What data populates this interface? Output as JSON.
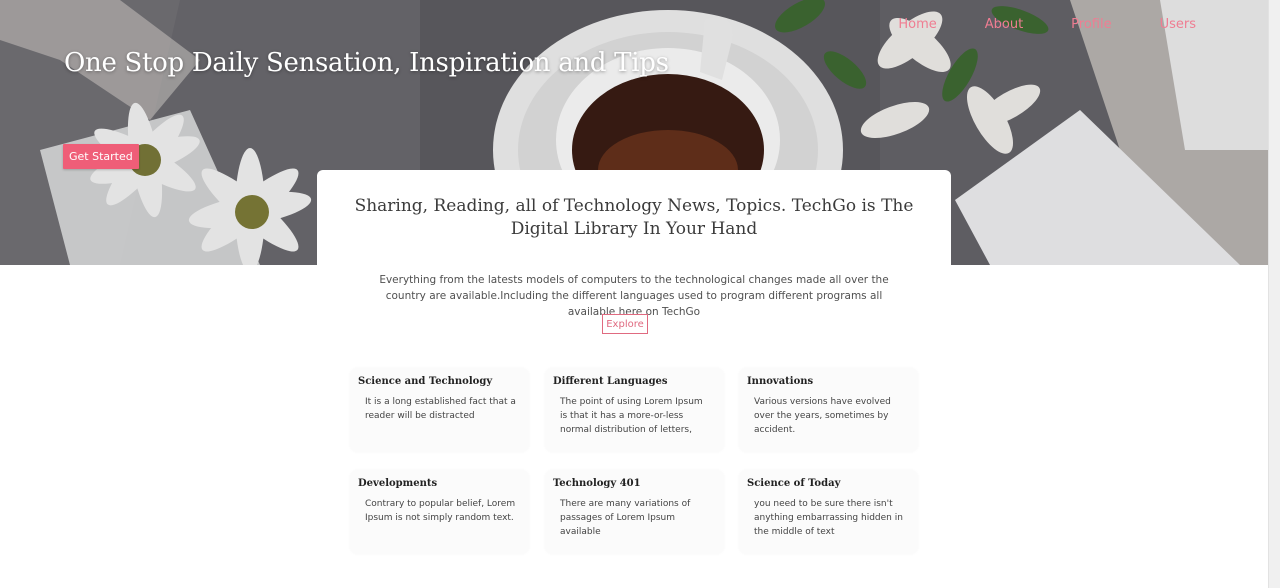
{
  "nav": {
    "home": "Home",
    "about": "About",
    "profile": "Profile",
    "users": "Users"
  },
  "hero": {
    "title": "One Stop Daily Sensation, Inspiration and Tips",
    "cta_label": "Get Started"
  },
  "intro": {
    "heading": "Sharing, Reading, all of Technology News, Topics. TechGo is The Digital Library In Your Hand",
    "text": "Everything from the latests models of computers to the technological changes made all over the country are available.Including the different languages used to program different programs all available here on TechGo",
    "explore_label": "Explore"
  },
  "features": [
    {
      "title": "Science and Technology",
      "text": "It is a long established fact that a reader will be distracted"
    },
    {
      "title": "Different Languages",
      "text": "The point of using Lorem Ipsum is that it has a more-or-less normal distribution of letters,"
    },
    {
      "title": "Innovations",
      "text": "Various versions have evolved over the years, sometimes by accident."
    },
    {
      "title": "Developments",
      "text": "Contrary to popular belief, Lorem Ipsum is not simply random text."
    },
    {
      "title": "Technology 401",
      "text": "There are many variations of passages of Lorem Ipsum available"
    },
    {
      "title": "Science of Today",
      "text": "you need to be sure there isn't anything embarrassing hidden in the middle of text"
    }
  ],
  "colors": {
    "accent": "#ef5e78",
    "nav_link": "#ef7d92",
    "card_bg": "#fbfbfb"
  }
}
